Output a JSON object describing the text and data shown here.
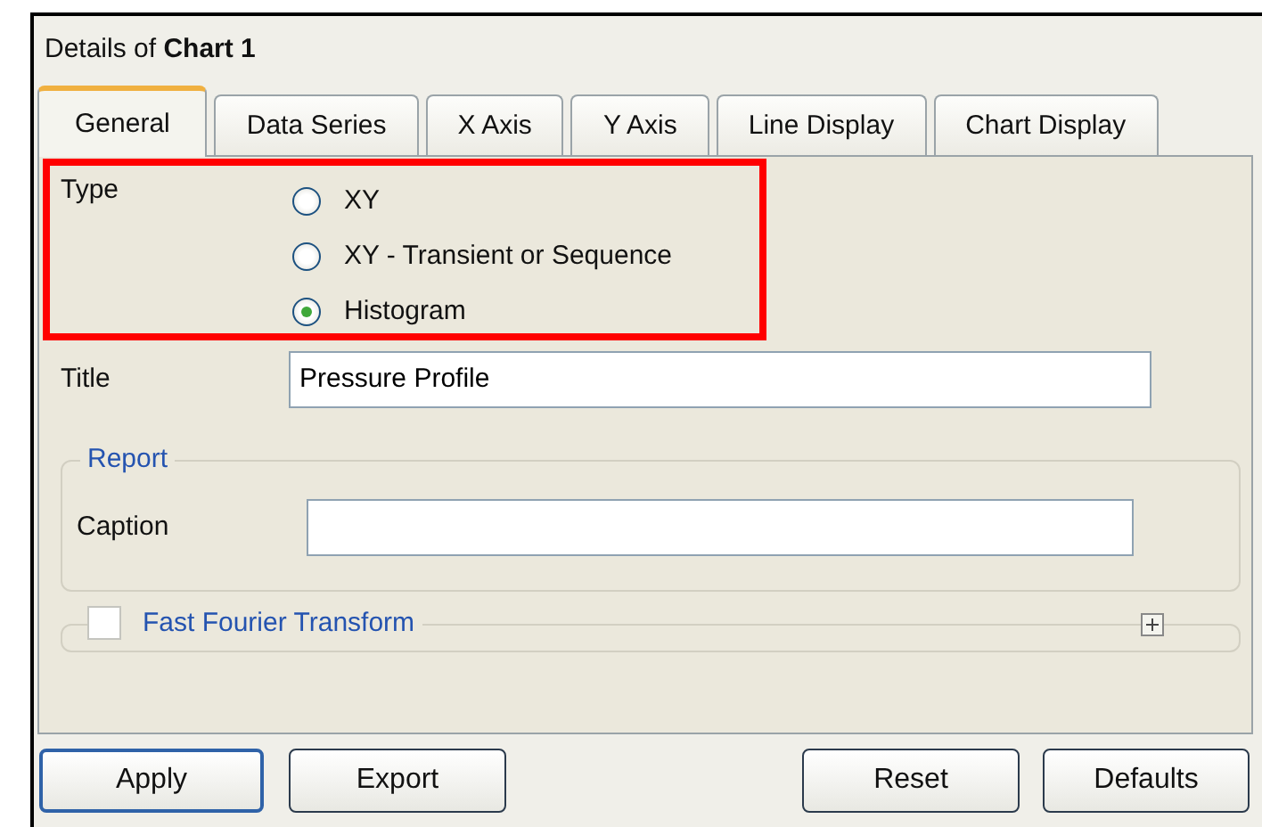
{
  "window": {
    "title_prefix": "Details of ",
    "title_name": "Chart 1"
  },
  "tabs": [
    {
      "label": "General",
      "selected": true
    },
    {
      "label": "Data Series",
      "selected": false
    },
    {
      "label": "X Axis",
      "selected": false
    },
    {
      "label": "Y Axis",
      "selected": false
    },
    {
      "label": "Line Display",
      "selected": false
    },
    {
      "label": "Chart Display",
      "selected": false
    }
  ],
  "type": {
    "label": "Type",
    "options": [
      {
        "label": "XY",
        "selected": false
      },
      {
        "label": "XY - Transient or Sequence",
        "selected": false
      },
      {
        "label": "Histogram",
        "selected": true
      }
    ]
  },
  "title_field": {
    "label": "Title",
    "value": "Pressure Profile"
  },
  "report": {
    "legend": "Report",
    "caption_label": "Caption"
  },
  "fft": {
    "label": "Fast Fourier Transform",
    "checked": false,
    "expanded": false
  },
  "buttons": [
    {
      "label": "Apply",
      "default": true
    },
    {
      "label": "Export",
      "default": false
    },
    {
      "label": "Reset",
      "default": false
    },
    {
      "label": "Defaults",
      "default": false
    }
  ]
}
